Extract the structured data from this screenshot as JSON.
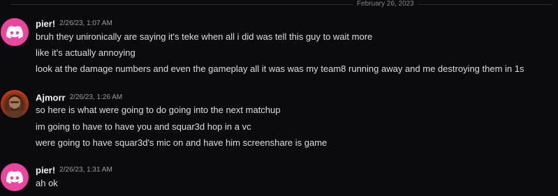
{
  "divider": {
    "date": "February 26, 2023"
  },
  "groups": [
    {
      "username": "pier!",
      "timestamp": "2/26/23, 1:07 AM",
      "avatar": "discord-logo-icon",
      "messages": [
        "bruh they unironically are saying it's teke when all i did was tell this guy to wait more",
        "like it's actually annoying",
        "look at the damage numbers and even the gameplay all it was was my team8 running away and me destroying them in 1s"
      ]
    },
    {
      "username": "Ajmorr",
      "timestamp": "2/26/23, 1:26 AM",
      "avatar": "user-photo",
      "messages": [
        "so here is what were going to do going into the next matchup",
        "im going to have to have you and squar3d hop in a vc",
        "were going to have squar3d's mic on and have him screenshare is game"
      ]
    },
    {
      "username": "pier!",
      "timestamp": "2/26/23, 1:31 AM",
      "avatar": "discord-logo-icon",
      "messages": [
        "ah ok"
      ]
    }
  ],
  "colors": {
    "background": "#0b0b0d",
    "discord_avatar": "#eb459e",
    "username": "#f2f3f5",
    "timestamp": "#949ba4",
    "message_text": "#dbdee1"
  }
}
